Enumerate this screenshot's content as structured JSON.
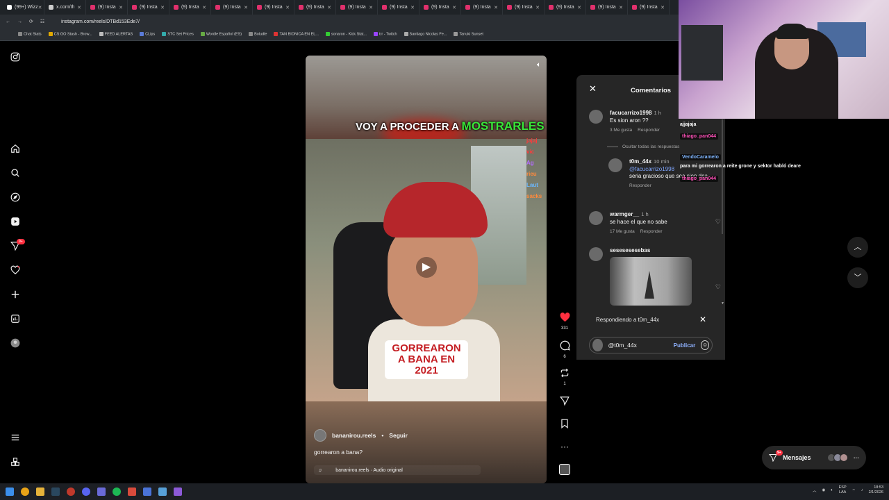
{
  "browser": {
    "tabs": [
      "(99+) Wizz",
      "x.com/th",
      "(9) Insta",
      "(9) Insta",
      "(9) Insta",
      "(9) Insta",
      "(9) Insta",
      "(9) Insta",
      "(9) Insta",
      "(9) Insta",
      "(9) Insta",
      "(9) Insta",
      "(9) Insta",
      "(9) Insta",
      "(9) Insta",
      "(9) Insta"
    ],
    "url": "instagram.com/reels/DTBd153Ede7/",
    "bookmarks": [
      "Chat Stats",
      "CS:GO Stash - Brow...",
      "FEED ALERTAS",
      "CLips",
      "STC Set Prices",
      "Wordle Español (ES)",
      "Boludle",
      "TAN BIONICA EN EL...",
      "sonaron - Kick Stat...",
      "trr - Twitch",
      "Santiago Nicolas Fe...",
      "Tanuki Sunset"
    ]
  },
  "sidebar": {
    "icons": [
      "instagram-logo-icon",
      "home-icon",
      "search-icon",
      "explore-icon",
      "reels-icon",
      "messages-icon",
      "notifications-icon",
      "create-icon",
      "dashboard-icon",
      "profile-avatar",
      "menu-icon",
      "also-from-meta-icon"
    ],
    "messages_badge": "9+"
  },
  "reel": {
    "overlay_text_1": "VOY A PROCEDER A",
    "overlay_text_highlight": "MOSTRARLES",
    "overlay_text_2": "GORREARON A BANA EN 2021",
    "username": "bananirou.reels",
    "follow_label": "Seguir",
    "separator": "•",
    "caption": "gorrearon a bana?",
    "audio": "bananirou.reels · Audio original",
    "chat_side": [
      "jajaj",
      "vic",
      "Ag",
      "rieu",
      "Laut",
      "sacks"
    ]
  },
  "actions": {
    "likes": "331",
    "comments": "6",
    "reposts": "1"
  },
  "comments_panel": {
    "title": "Comentarios",
    "hide_replies": "Ocultar todas las respuestas",
    "reply_label": "Responder",
    "items": [
      {
        "user": "facucarrizo1998",
        "time": "1 h",
        "text": "Es sion aron ??",
        "likes": "3 Me gusta"
      },
      {
        "user": "t0m_44x",
        "time": "10 min",
        "mention": "@facucarrizo1998",
        "text": "seria gracioso que sea sion dea"
      },
      {
        "user": "warmger__",
        "time": "1 h",
        "text": "se hace el que no sabe",
        "likes": "17 Me gusta"
      },
      {
        "user": "sesesesesebas",
        "time": "",
        "text": ""
      }
    ],
    "replying_to": "Respondiendo a t0m_44x",
    "input_value": "@t0m_44x ",
    "publish_label": "Publicar"
  },
  "twitch_chat": [
    {
      "user": "",
      "text": "ajjajaja"
    },
    {
      "user": "thiago_pan044",
      "text": ""
    },
    {
      "user": "VendoCaramelo",
      "text": "para mi gorrearon a reite grone y sektor habló deare"
    },
    {
      "user": "thiago_pan044",
      "text": ""
    }
  ],
  "messages_pill": {
    "label": "Mensajes",
    "badge": "9+"
  },
  "taskbar": {
    "lang_1": "ESP",
    "lang_2": "LAA",
    "time": "18:53",
    "date": "2/1/2026"
  },
  "colors": {
    "heart": "#ff3040",
    "accent_link": "#7fa6ff",
    "caption_green": "#39e639",
    "caption_red": "#c41d22"
  }
}
